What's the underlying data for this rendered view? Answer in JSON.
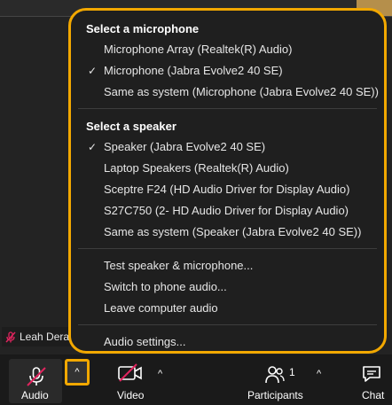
{
  "menu": {
    "microphone_section": {
      "title": "Select a microphone",
      "items": [
        {
          "label": "Microphone Array (Realtek(R) Audio)",
          "checked": false
        },
        {
          "label": "Microphone (Jabra Evolve2 40 SE)",
          "checked": true
        },
        {
          "label": "Same as system (Microphone (Jabra Evolve2 40 SE))",
          "checked": false
        }
      ]
    },
    "speaker_section": {
      "title": "Select a speaker",
      "items": [
        {
          "label": "Speaker (Jabra Evolve2 40 SE)",
          "checked": true
        },
        {
          "label": "Laptop Speakers (Realtek(R) Audio)",
          "checked": false
        },
        {
          "label": "Sceptre F24 (HD Audio Driver for Display Audio)",
          "checked": false
        },
        {
          "label": "S27C750 (2- HD Audio Driver for Display Audio)",
          "checked": false
        },
        {
          "label": "Same as system (Speaker (Jabra Evolve2 40 SE))",
          "checked": false
        }
      ]
    },
    "actions": [
      {
        "label": "Test speaker & microphone..."
      },
      {
        "label": "Switch to phone audio..."
      },
      {
        "label": "Leave computer audio"
      }
    ],
    "settings_label": "Audio settings...",
    "check_glyph": "✓"
  },
  "participant_tile": {
    "name": "Leah Dera"
  },
  "toolbar": {
    "audio_label": "Audio",
    "video_label": "Video",
    "participants_label": "Participants",
    "participants_count": "1",
    "chat_label": "Chat",
    "caret_glyph": "^"
  },
  "colors": {
    "highlight": "#f2a800",
    "mute_red": "#e0245e",
    "menu_bg": "#1f1f1f"
  }
}
